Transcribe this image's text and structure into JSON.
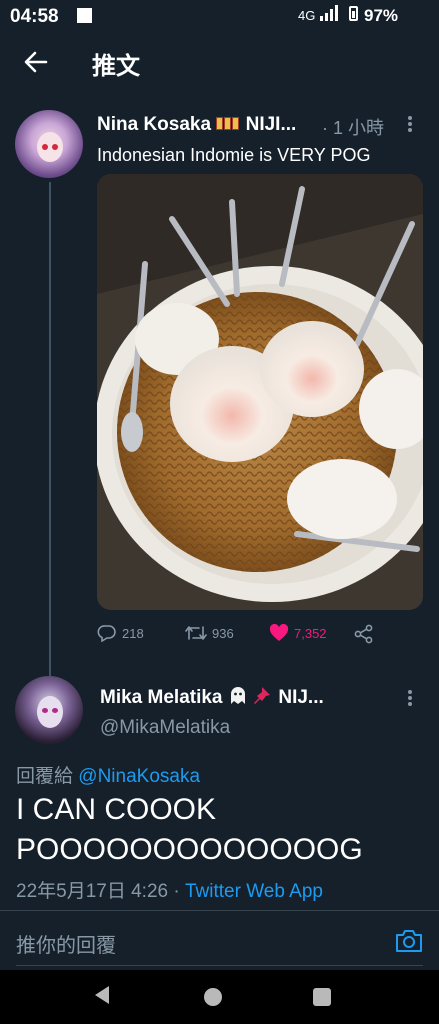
{
  "status_bar": {
    "time": "04:58",
    "network": "4G",
    "battery": "97%"
  },
  "header": {
    "title": "推文"
  },
  "tweet": {
    "author_name": "Nina Kosaka",
    "author_name_suffix": "NIJI...",
    "time_ago": "1 小時",
    "text": "Indonesian Indomie is VERY POG",
    "reply_count": "218",
    "retweet_count": "936",
    "like_count": "7,352"
  },
  "reply": {
    "author_name": "Mika Melatika",
    "author_name_suffix": "NIJ...",
    "handle": "@MikaMelatika",
    "reply_prefix": "回覆給",
    "reply_to": "@NinaKosaka",
    "text": "I CAN COOOK POOOOOOOOOOOOOG",
    "date": "22年5月17日 4:26",
    "source": "Twitter Web App"
  },
  "compose": {
    "placeholder": "推你的回覆"
  },
  "colors": {
    "background": "#15202b",
    "accent": "#1d9bf0",
    "like": "#f91880",
    "muted": "#8899a6"
  },
  "icons": [
    "back-arrow-icon",
    "more-icon",
    "reply-icon",
    "retweet-icon",
    "heart-icon",
    "share-icon",
    "ghost-icon",
    "pin-icon",
    "camera-icon",
    "nav-back-icon",
    "nav-home-icon",
    "nav-recent-icon"
  ]
}
